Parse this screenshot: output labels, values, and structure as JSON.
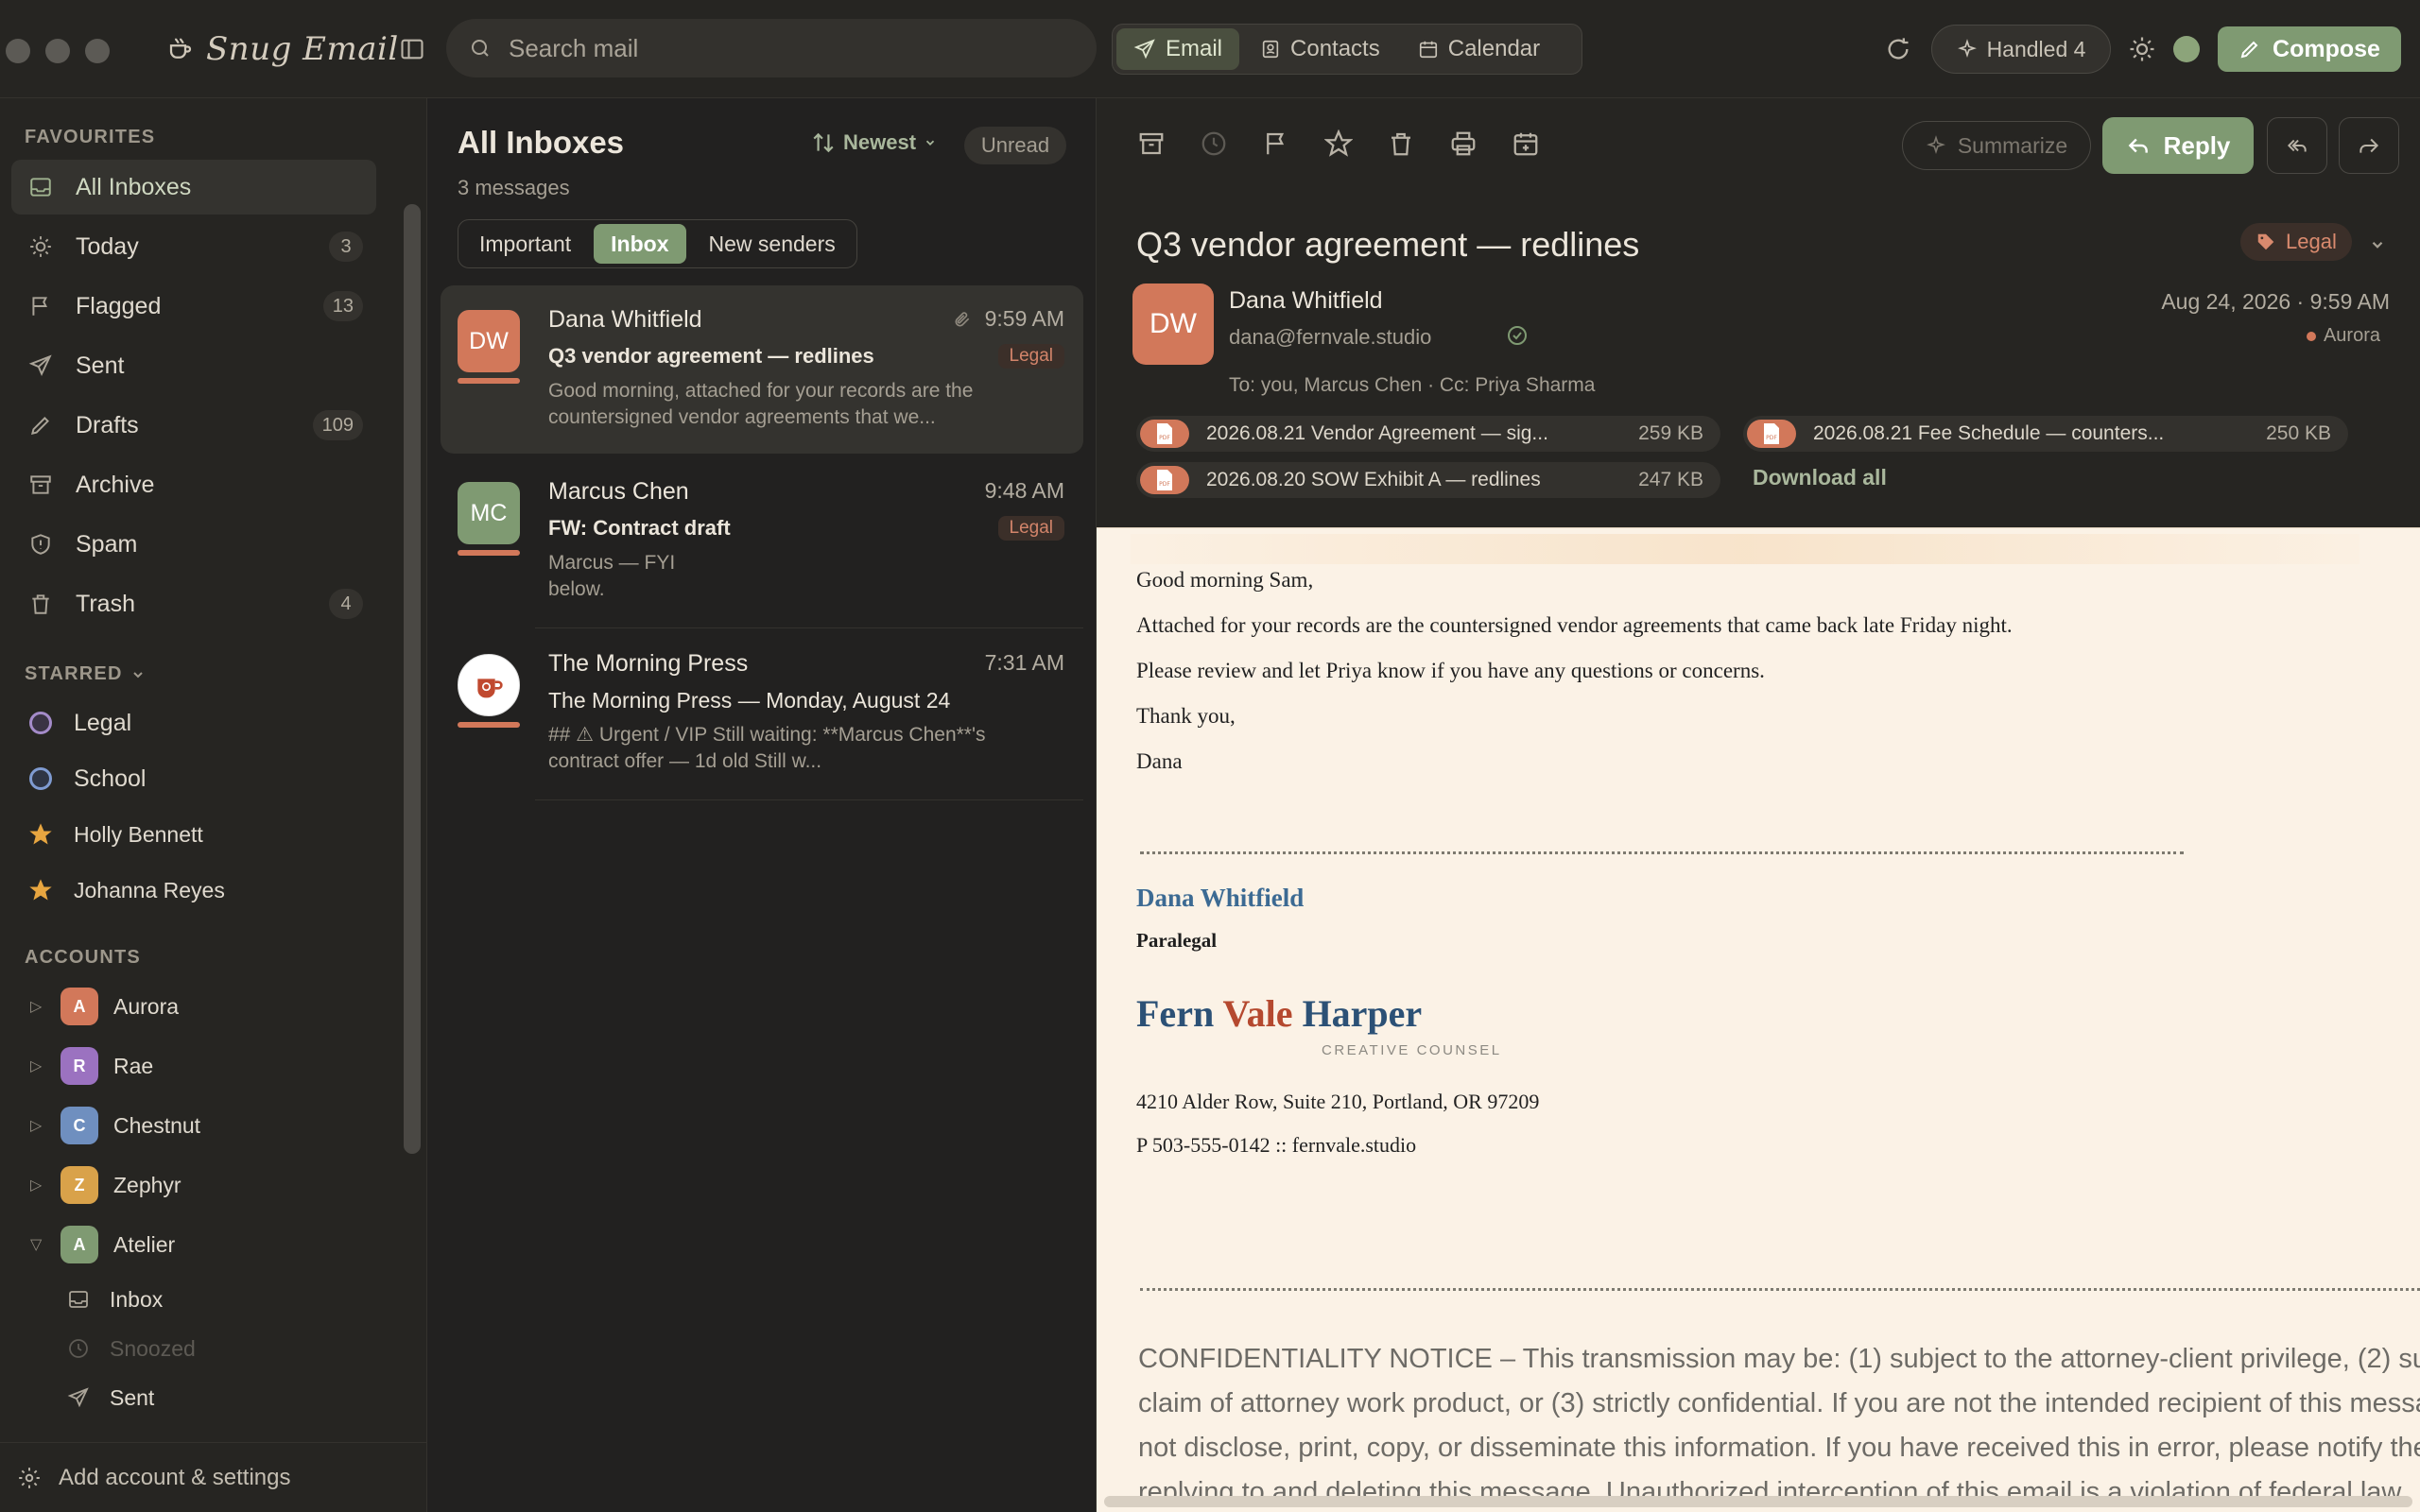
{
  "app": {
    "name": "Snug Email"
  },
  "search": {
    "placeholder": "Search mail"
  },
  "modes": [
    {
      "label": "Email"
    },
    {
      "label": "Contacts"
    },
    {
      "label": "Calendar"
    }
  ],
  "toolbar": {
    "handled_label": "Handled 4",
    "compose_label": "Compose"
  },
  "sidebar": {
    "favourites_title": "FAVOURITES",
    "favourites": [
      {
        "label": "All Inboxes",
        "badge": ""
      },
      {
        "label": "Today",
        "badge": "3"
      },
      {
        "label": "Flagged",
        "badge": "13"
      },
      {
        "label": "Sent",
        "badge": ""
      },
      {
        "label": "Drafts",
        "badge": "109"
      },
      {
        "label": "Archive",
        "badge": ""
      },
      {
        "label": "Spam",
        "badge": ""
      },
      {
        "label": "Trash",
        "badge": "4"
      }
    ],
    "starred_title": "STARRED",
    "starred": [
      {
        "label": "Legal",
        "color": "#a48bc9"
      },
      {
        "label": "School",
        "color": "#7f9bd1"
      },
      {
        "label": "Holly Bennett",
        "color": "#e8a640"
      },
      {
        "label": "Johanna Reyes",
        "color": "#e8a640"
      }
    ],
    "accounts_title": "ACCOUNTS",
    "accounts": [
      {
        "label": "Aurora",
        "initial": "A",
        "color": "#d2785a"
      },
      {
        "label": "Rae",
        "initial": "R",
        "color": "#9b72c0"
      },
      {
        "label": "Chestnut",
        "initial": "C",
        "color": "#6f8fbf"
      },
      {
        "label": "Zephyr",
        "initial": "Z",
        "color": "#d9a24a"
      },
      {
        "label": "Atelier",
        "initial": "A",
        "color": "#7f9a72"
      }
    ],
    "sub_items": [
      {
        "label": "Inbox"
      },
      {
        "label": "Snoozed"
      },
      {
        "label": "Sent"
      }
    ],
    "footer_label": "Add account & settings"
  },
  "list": {
    "title": "All Inboxes",
    "count": "3 messages",
    "sort_label": "Newest",
    "unread_label": "Unread",
    "filters": [
      {
        "label": "Important"
      },
      {
        "label": "Inbox"
      },
      {
        "label": "New senders"
      }
    ],
    "messages": [
      {
        "initials": "DW",
        "from": "Dana Whitfield",
        "time": "9:59 AM",
        "subject": "Q3 vendor agreement — redlines",
        "tag": "Legal",
        "preview": "Good morning, attached for your records are the countersigned vendor agreements that we...",
        "color": "#d2785a"
      },
      {
        "initials": "MC",
        "from": "Marcus Chen",
        "time": "9:48 AM",
        "subject": "FW: Contract draft",
        "tag": "Legal",
        "preview": "Marcus — FYI\nbelow.",
        "color": "#7f9a72"
      },
      {
        "initials": "",
        "from": "The Morning Press",
        "time": "7:31 AM",
        "subject": "The Morning Press — Monday, August 24",
        "tag": "",
        "preview": "## ⚠ Urgent / VIP Still waiting: **Marcus Chen**'s contract offer — 1d old  Still w...",
        "color": "#ffffff"
      }
    ]
  },
  "reader": {
    "summarize_label": "Summarize",
    "reply_label": "Reply",
    "subject": "Q3 vendor agreement — redlines",
    "tag": "Legal",
    "from_initials": "DW",
    "from_name": "Dana Whitfield",
    "from_email": "dana@fernvale.studio",
    "to_line": "To: you, Marcus Chen · Cc: Priya Sharma",
    "date": "Aug 24, 2026 · 9:59 AM",
    "account": "Aurora",
    "attachments": [
      {
        "name": "2026.08.21 Vendor Agreement — sig...",
        "size": "259 KB"
      },
      {
        "name": "2026.08.21 Fee Schedule — counters...",
        "size": "250 KB"
      },
      {
        "name": "2026.08.20 SOW Exhibit A — redlines",
        "size": "247 KB"
      }
    ],
    "download_all": "Download all",
    "body": {
      "lines": [
        "Good morning Sam,",
        "Attached for your records are the countersigned vendor agreements that came back late Friday night.",
        "Please review and let Priya know if you have any questions or concerns.",
        "Thank you,",
        "Dana"
      ],
      "sig_name": "Dana Whitfield",
      "sig_title": "Paralegal",
      "logo_fern": "Fern",
      "logo_vale": "Vale",
      "logo_harper": "Harper",
      "logo_sub": "CREATIVE COUNSEL",
      "address": "4210 Alder Row, Suite 210, Portland, OR 97209",
      "phone": "P 503-555-0142 :: fernvale.studio",
      "confidentiality": [
        "CONFIDENTIALITY NOTICE – This transmission may be: (1) subject to the attorney-client privilege, (2) sul",
        "claim of attorney work product, or (3) strictly confidential. If you are not the intended recipient of this messa",
        "not disclose, print, copy, or disseminate this information. If you have received this in error, please notify the",
        "replying to and deleting this message. Unauthorized interception of this email is a violation of federal law."
      ]
    }
  }
}
